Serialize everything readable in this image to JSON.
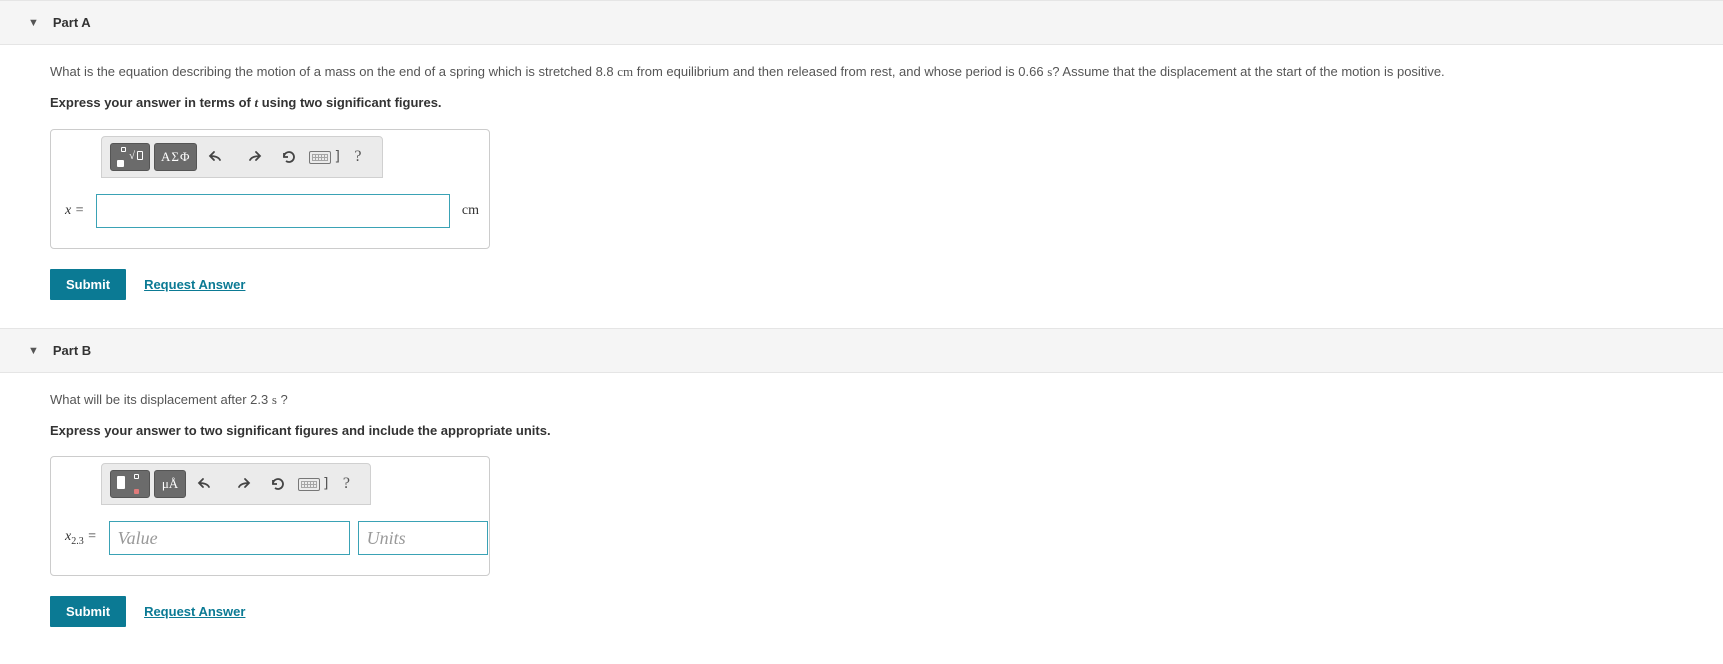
{
  "partA": {
    "title": "Part A",
    "question_pre": "What is the equation describing the motion of a mass on the end of a spring which is stretched 8.8 ",
    "question_unit1": "cm",
    "question_mid": " from equilibrium and then released from rest, and whose period is 0.66 ",
    "question_unit2": "s",
    "question_post": "? Assume that the displacement at the start of the motion is positive.",
    "instructions_pre": "Express your answer in terms of ",
    "instructions_var": "t",
    "instructions_post": " using two significant figures.",
    "toolbar": {
      "templates": "templates",
      "greek": "ΑΣΦ",
      "undo": "undo",
      "redo": "redo",
      "reset": "reset",
      "keyboard": "keyboard",
      "help": "?"
    },
    "var_label": "x",
    "equals": " = ",
    "unit": "cm",
    "submit": "Submit",
    "request": "Request Answer"
  },
  "partB": {
    "title": "Part B",
    "question_pre": "What will be its displacement after 2.3 ",
    "question_unit1": "s",
    "question_post": " ?",
    "instructions": "Express your answer to two significant figures and include the appropriate units.",
    "toolbar": {
      "templates": "templates",
      "units_mu": "μÅ",
      "undo": "undo",
      "redo": "redo",
      "reset": "reset",
      "keyboard": "keyboard",
      "help": "?"
    },
    "var_label": "x",
    "var_sub": "2.3",
    "equals": " = ",
    "value_placeholder": "Value",
    "units_placeholder": "Units",
    "submit": "Submit",
    "request": "Request Answer"
  }
}
